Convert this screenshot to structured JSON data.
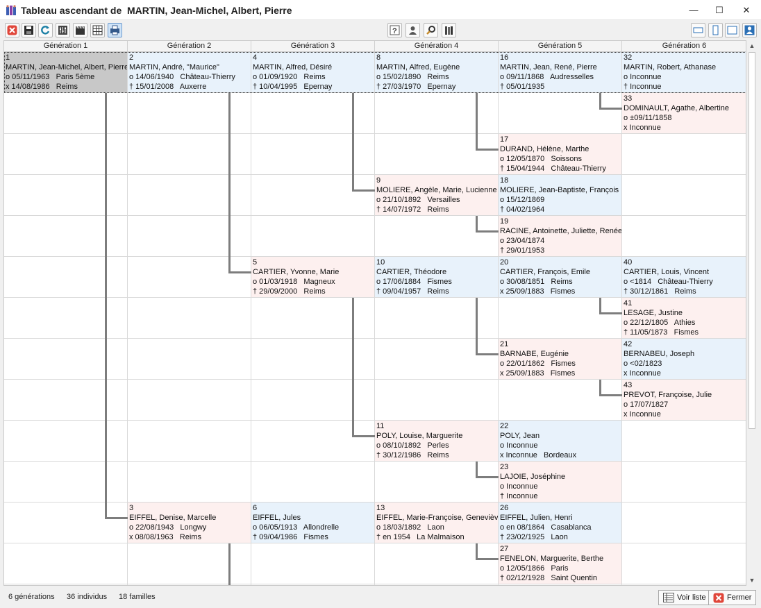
{
  "window": {
    "title": "Tableau ascendant de  MARTIN, Jean-Michel, Albert, Pierre",
    "minimize": "—",
    "maximize": "☐",
    "close": "✕"
  },
  "columns": [
    "Génération 1",
    "Génération 2",
    "Génération 3",
    "Génération 4",
    "Génération 5",
    "Génération 6"
  ],
  "people": [
    {
      "num": "1",
      "name": "MARTIN, Jean-Michel, Albert, Pierre",
      "l1": "o 05/11/1963   Paris 5ème",
      "l2": "x 14/08/1986   Reims"
    },
    {
      "num": "2",
      "name": "MARTIN, André, \"Maurice\"",
      "l1": "o 14/06/1940   Château-Thierry",
      "l2": "† 15/01/2008   Auxerre"
    },
    {
      "num": "4",
      "name": "MARTIN, Alfred, Désiré",
      "l1": "o 01/09/1920   Reims",
      "l2": "† 10/04/1995   Epernay"
    },
    {
      "num": "8",
      "name": "MARTIN, Alfred, Eugène",
      "l1": "o 15/02/1890   Reims",
      "l2": "† 27/03/1970   Epernay"
    },
    {
      "num": "16",
      "name": "MARTIN, Jean, René, Pierre",
      "l1": "o 09/11/1868   Audresselles",
      "l2": "† 05/01/1935"
    },
    {
      "num": "32",
      "name": "MARTIN, Robert, Athanase",
      "l1": "o Inconnue",
      "l2": "† Inconnue"
    },
    {
      "num": "33",
      "name": "DOMINAULT, Agathe, Albertine",
      "l1": "o ±09/11/1858",
      "l2": "x Inconnue"
    },
    {
      "num": "17",
      "name": "DURAND, Hélène, Marthe",
      "l1": "o 12/05/1870   Soissons",
      "l2": "† 15/04/1944   Château-Thierry"
    },
    {
      "num": "9",
      "name": "MOLIERE, Angèle, Marie, Lucienne",
      "l1": "o 21/10/1892   Versailles",
      "l2": "† 14/07/1972   Reims"
    },
    {
      "num": "18",
      "name": "MOLIERE, Jean-Baptiste, François",
      "l1": "o 15/12/1869",
      "l2": "† 04/02/1964"
    },
    {
      "num": "19",
      "name": "RACINE, Antoinette, Juliette, Renée",
      "l1": "o 23/04/1874",
      "l2": "† 29/01/1953"
    },
    {
      "num": "5",
      "name": "CARTIER, Yvonne, Marie",
      "l1": "o 01/03/1918   Magneux",
      "l2": "† 29/09/2000   Reims"
    },
    {
      "num": "10",
      "name": "CARTIER, Théodore",
      "l1": "o 17/06/1884   Fismes",
      "l2": "† 09/04/1957   Reims"
    },
    {
      "num": "20",
      "name": "CARTIER, François, Emile",
      "l1": "o 30/08/1851   Reims",
      "l2": "x 25/09/1883   Fismes"
    },
    {
      "num": "40",
      "name": "CARTIER, Louis, Vincent",
      "l1": "o <1814   Château-Thierry",
      "l2": "† 30/12/1861   Reims"
    },
    {
      "num": "41",
      "name": "LESAGE, Justine",
      "l1": "o 22/12/1805   Athies",
      "l2": "† 11/05/1873   Fismes"
    },
    {
      "num": "21",
      "name": "BARNABE, Eugénie",
      "l1": "o 22/01/1862   Fismes",
      "l2": "x 25/09/1883   Fismes"
    },
    {
      "num": "42",
      "name": "BERNABEU, Joseph",
      "l1": "o <02/1823",
      "l2": "x Inconnue"
    },
    {
      "num": "43",
      "name": "PREVOT, Françoise, Julie",
      "l1": "o 17/07/1827",
      "l2": "x Inconnue"
    },
    {
      "num": "11",
      "name": "POLY, Louise, Marguerite",
      "l1": "o 08/10/1892   Perles",
      "l2": "† 30/12/1986   Reims"
    },
    {
      "num": "22",
      "name": "POLY, Jean",
      "l1": "o Inconnue",
      "l2": "x Inconnue   Bordeaux"
    },
    {
      "num": "23",
      "name": "LAJOIE, Joséphine",
      "l1": "o Inconnue",
      "l2": "† Inconnue"
    },
    {
      "num": "3",
      "name": "EIFFEL, Denise, Marcelle",
      "l1": "o 22/08/1943   Longwy",
      "l2": "x 08/08/1963   Reims"
    },
    {
      "num": "6",
      "name": "EIFFEL, Jules",
      "l1": "o 06/05/1913   Allondrelle",
      "l2": "† 09/04/1986   Fismes"
    },
    {
      "num": "13",
      "name": "EIFFEL, Marie-Françoise, Geneviève",
      "l1": "o 18/03/1892   Laon",
      "l2": "† en 1954   La Malmaison"
    },
    {
      "num": "26",
      "name": "EIFFEL, Julien, Henri",
      "l1": "o en 08/1864   Casablanca",
      "l2": "† 23/02/1925   Laon"
    },
    {
      "num": "27",
      "name": "FENELON, Marguerite, Berthe",
      "l1": "o 12/05/1866   Paris",
      "l2": "† 02/12/1928   Saint Quentin"
    }
  ],
  "status": {
    "generations": "6 générations",
    "individuals": "36 individus",
    "families": "18 familles"
  },
  "buttons": {
    "list": "Voir liste",
    "close": "Fermer"
  }
}
